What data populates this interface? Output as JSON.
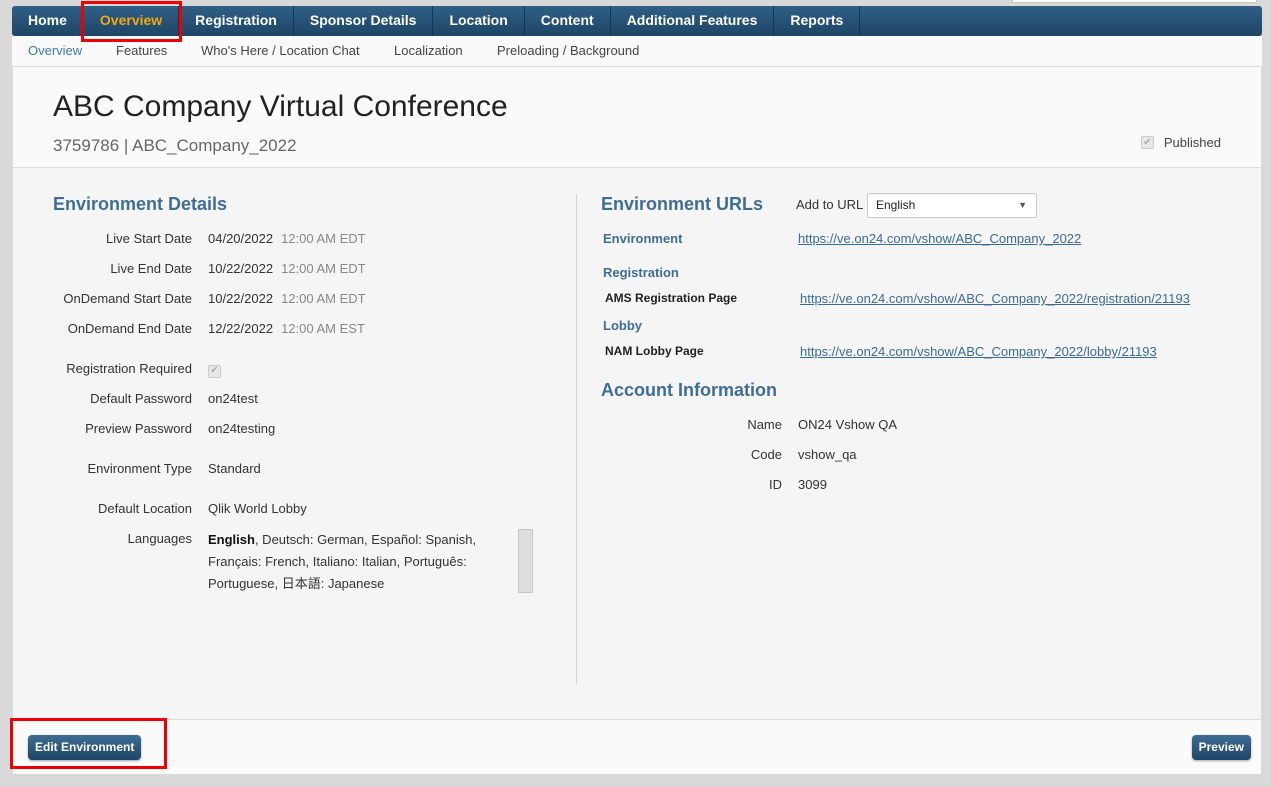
{
  "top_nav": {
    "items": [
      "Home",
      "Overview",
      "Registration",
      "Sponsor Details",
      "Location",
      "Content",
      "Additional Features",
      "Reports"
    ],
    "active": "Overview"
  },
  "sub_nav": {
    "items": [
      "Overview",
      "Features",
      "Who's Here / Location Chat",
      "Localization",
      "Preloading / Background"
    ],
    "active": "Overview"
  },
  "header": {
    "title": "ABC Company Virtual Conference",
    "subtitle": "3759786 | ABC_Company_2022",
    "published_label": "Published",
    "published_checked": true
  },
  "env_details": {
    "title": "Environment Details",
    "live_start": {
      "label": "Live Start Date",
      "date": "04/20/2022",
      "time": "12:00 AM EDT"
    },
    "live_end": {
      "label": "Live End Date",
      "date": "10/22/2022",
      "time": "12:00 AM EDT"
    },
    "ondemand_start": {
      "label": "OnDemand Start Date",
      "date": "10/22/2022",
      "time": "12:00 AM EDT"
    },
    "ondemand_end": {
      "label": "OnDemand End Date",
      "date": "12/22/2022",
      "time": "12:00 AM EST"
    },
    "registration_required": {
      "label": "Registration Required",
      "checked": true
    },
    "default_password": {
      "label": "Default Password",
      "value": "on24test"
    },
    "preview_password": {
      "label": "Preview Password",
      "value": "on24testing"
    },
    "environment_type": {
      "label": "Environment Type",
      "value": "Standard"
    },
    "default_location": {
      "label": "Default Location",
      "value": "Qlik World Lobby"
    },
    "languages": {
      "label": "Languages",
      "primary": "English",
      "rest": ", Deutsch: German, Español: Spanish, Français: French, Italiano: Italian, Português: Portuguese, 日本語: Japanese"
    }
  },
  "env_urls": {
    "title": "Environment URLs",
    "add_to_url_label": "Add to URL",
    "language_select": "English",
    "environment_label": "Environment",
    "environment_url": "https://ve.on24.com/vshow/ABC_Company_2022",
    "registration_label": "Registration",
    "ams_label": "AMS Registration Page",
    "ams_url": "https://ve.on24.com/vshow/ABC_Company_2022/registration/21193",
    "lobby_label": "Lobby",
    "nam_label": "NAM Lobby Page",
    "nam_url": "https://ve.on24.com/vshow/ABC_Company_2022/lobby/21193"
  },
  "account": {
    "title": "Account Information",
    "name_label": "Name",
    "name": "ON24 Vshow QA",
    "code_label": "Code",
    "code": "vshow_qa",
    "id_label": "ID",
    "id": "3099"
  },
  "footer": {
    "edit_label": "Edit Environment",
    "preview_label": "Preview"
  },
  "highlight_color": "#ee0000"
}
